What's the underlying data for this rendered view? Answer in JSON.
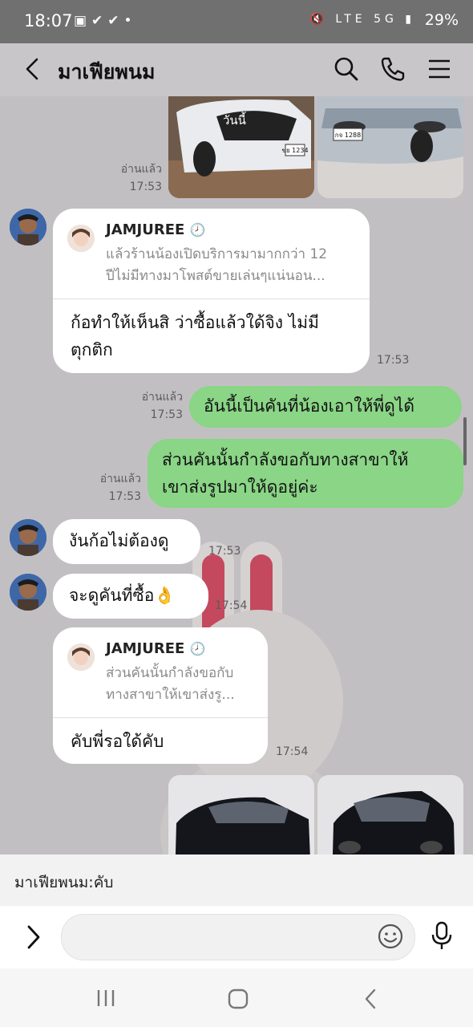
{
  "status_bar": {
    "time": "18:07",
    "battery": "29%",
    "network": "5G"
  },
  "header": {
    "title": "มาเฟียพนม"
  },
  "messages": {
    "top_image": {
      "overlay_label": "วันนี้",
      "read_label": "อ่านแล้ว",
      "time": "17:53",
      "plate_left": "ขย 1234",
      "plate_right": "กจ 1288"
    },
    "reply1": {
      "reply_name": "JAMJUREE",
      "reply_text_line1": "แล้วร้านน้องเปิดบริการมามากกว่า 12",
      "reply_text_line2": "ปีไม่มีทางมาโพสต์ขายเล่นๆแน่นอน...",
      "text_line1": "ก้อทำให้เห็นสิ ว่าซื้อแล้วใด้จิง ไม่มี",
      "text_line2": "ตุกติก",
      "time": "17:53"
    },
    "out1": {
      "read_label": "อ่านแล้ว",
      "time": "17:53",
      "text": "อันนี้เป็นคันที่น้องเอาให้พี่ดูได้"
    },
    "out2": {
      "read_label": "อ่านแล้ว",
      "time": "17:53",
      "text_line1": "ส่วนคันนั้นกำลังขอกับทางสาขาให้",
      "text_line2": "เขาส่งรูปมาให้ดูอยู่ค่ะ"
    },
    "in2": {
      "text": "งันก้อไม่ต้องดู",
      "time": "17:53"
    },
    "in3": {
      "text": "จะดูคันที่ซื้อ👌",
      "time": "17:54"
    },
    "reply2": {
      "reply_name": "JAMJUREE",
      "reply_text_line1": "ส่วนคันนั้นกำลังขอกับ",
      "reply_text_line2": "ทางสาขาให้เขาส่งรู...",
      "text": "คับพี่รอใด้คับ",
      "time": "17:54"
    }
  },
  "preview": {
    "text": "มาเฟียพนม:คับ"
  },
  "colors": {
    "outgoing_bubble": "#8ad586",
    "incoming_bubble": "#ffffff",
    "chat_background": "#c2bfc3"
  }
}
